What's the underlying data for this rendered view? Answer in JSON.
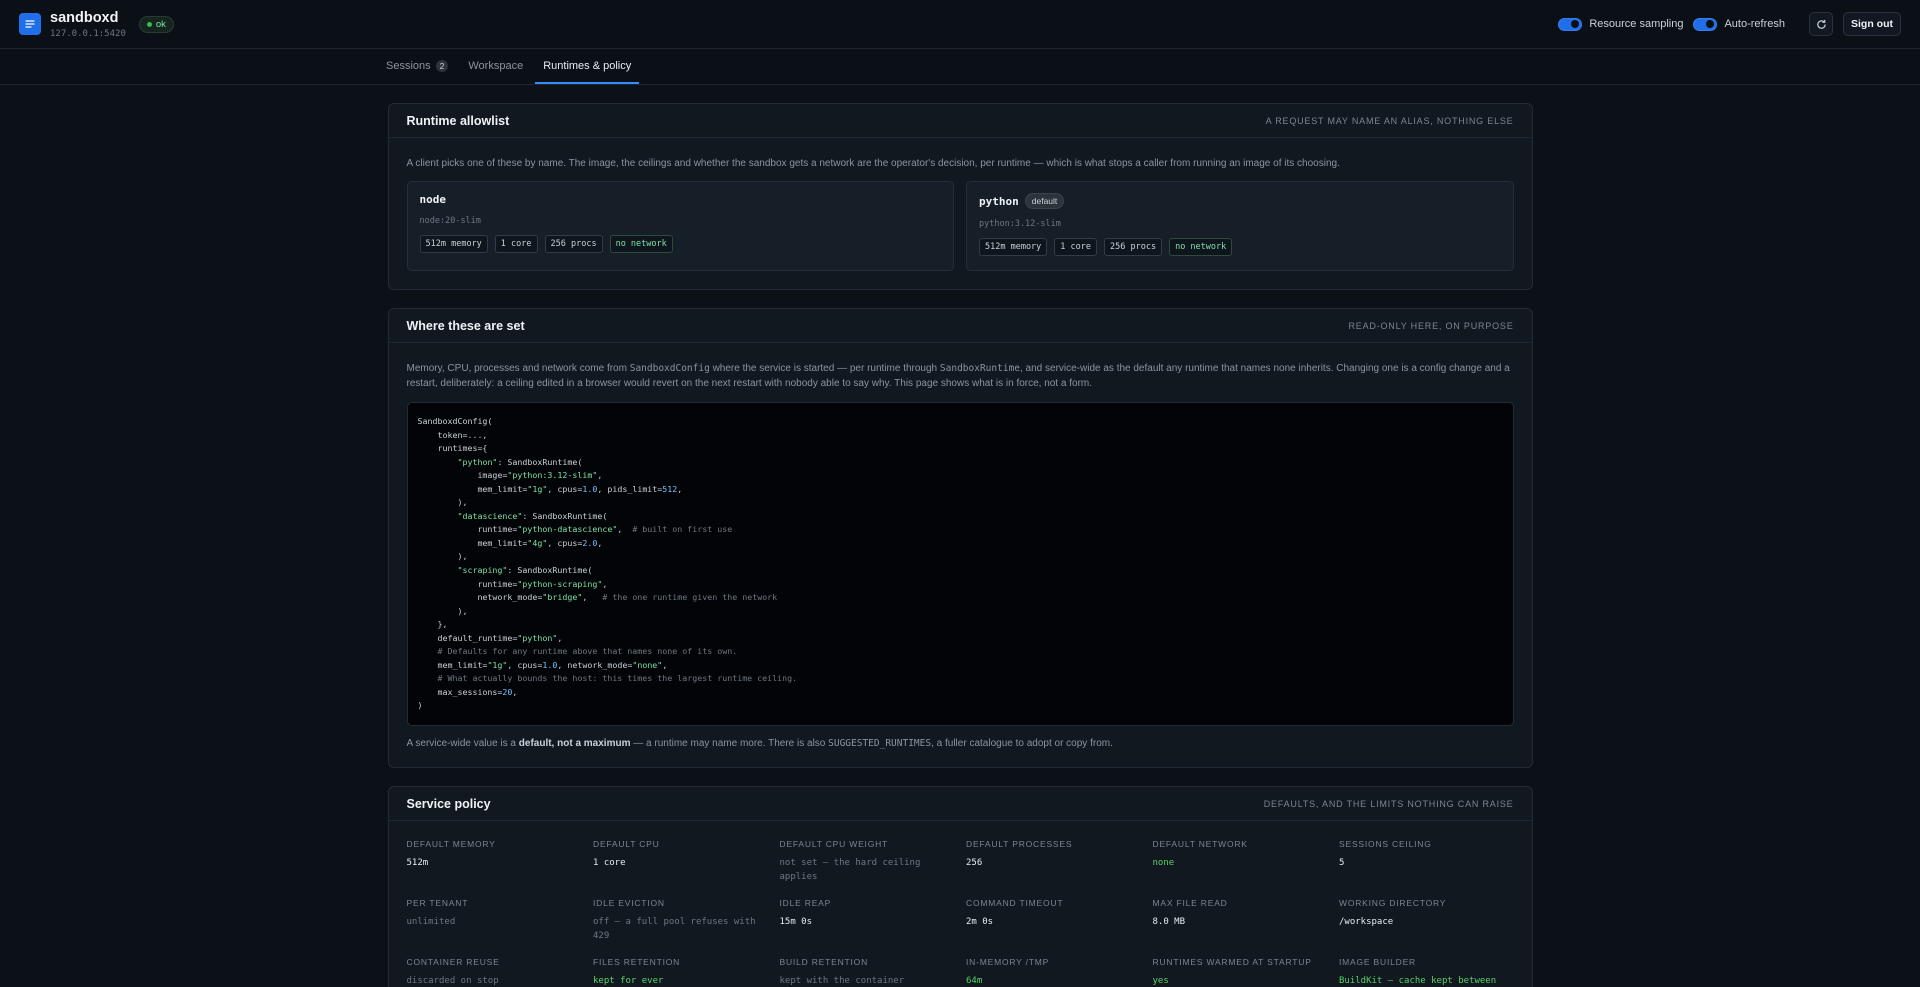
{
  "app": {
    "name": "sandboxd",
    "address": "127.0.0.1:5420",
    "status": "ok",
    "toggles": [
      {
        "label": "Resource sampling",
        "on": true
      },
      {
        "label": "Auto-refresh",
        "on": true
      }
    ],
    "refresh_icon": "refresh-icon",
    "sign_out": "Sign out"
  },
  "tabs": [
    {
      "label": "Sessions",
      "count": "2"
    },
    {
      "label": "Workspace",
      "count": ""
    },
    {
      "label": "Runtimes & policy",
      "count": "",
      "active": true
    }
  ],
  "allowlist": {
    "title": "Runtime allowlist",
    "note": "A request may name an alias, nothing else",
    "description": "A client picks one of these by name. The image, the ceilings and whether the sandbox gets a network are the operator's decision, per runtime — which is what stops a caller from running an image of its choosing.",
    "runtimes": [
      {
        "name": "node",
        "default_badge": "",
        "image": "node:20-slim",
        "chips": [
          "512m memory",
          "1 core",
          "256 procs",
          "no network"
        ]
      },
      {
        "name": "python",
        "default_badge": "default",
        "image": "python:3.12-slim",
        "chips": [
          "512m memory",
          "1 core",
          "256 procs",
          "no network"
        ]
      }
    ]
  },
  "config": {
    "title": "Where these are set",
    "note": "Read-only here, on purpose",
    "desc_parts": {
      "p1": "Memory, CPU, processes and network come from ",
      "code1": "SandboxdConfig",
      "p2": " where the service is started — per runtime through ",
      "code2": "SandboxRuntime",
      "p3": ", and service-wide as the default any runtime that names none inherits. Changing one is a config change and a restart, deliberately: a ceiling edited in a browser would revert on the next restart with nobody able to say why. This page shows what is in force, not a form."
    },
    "code_lines": [
      "SandboxdConfig(",
      "    token=...,",
      "    runtimes={",
      "        \"python\": SandboxRuntime(",
      "            image=\"python:3.12-slim\",",
      "            mem_limit=\"1g\", cpus=1.0, pids_limit=512,",
      "        ),",
      "        \"datascience\": SandboxRuntime(",
      "            runtime=\"python-datascience\",  # built on first use",
      "            mem_limit=\"4g\", cpus=2.0,",
      "        ),",
      "        \"scraping\": SandboxRuntime(",
      "            runtime=\"python-scraping\",",
      "            network_mode=\"bridge\",   # the one runtime given the network",
      "        ),",
      "    },",
      "    default_runtime=\"python\",",
      "    # Defaults for any runtime above that names none of its own.",
      "    mem_limit=\"1g\", cpus=1.0, network_mode=\"none\",",
      "    # What actually bounds the host: this times the largest runtime ceiling.",
      "    max_sessions=20,",
      ")"
    ],
    "foot_parts": {
      "p1": "A service-wide value is a ",
      "bold": "default, not a maximum",
      "p2": " — a runtime may name more. There is also ",
      "code": "SUGGESTED_RUNTIMES",
      "p3": ", a fuller catalogue to adopt or copy from."
    }
  },
  "policy": {
    "title": "Service policy",
    "note": "Defaults, and the limits nothing can raise",
    "items": [
      {
        "label": "Default memory",
        "value": "512m",
        "tone": ""
      },
      {
        "label": "Default CPU",
        "value": "1 core",
        "tone": ""
      },
      {
        "label": "Default CPU weight",
        "value": "not set — the hard ceiling applies",
        "tone": "muted"
      },
      {
        "label": "Default processes",
        "value": "256",
        "tone": ""
      },
      {
        "label": "Default network",
        "value": "none",
        "tone": "green"
      },
      {
        "label": "Sessions ceiling",
        "value": "5",
        "tone": ""
      },
      {
        "label": "Per tenant",
        "value": "unlimited",
        "tone": "muted"
      },
      {
        "label": "Idle eviction",
        "value": "off — a full pool refuses with 429",
        "tone": "muted"
      },
      {
        "label": "Idle reap",
        "value": "15m 0s",
        "tone": ""
      },
      {
        "label": "Command timeout",
        "value": "2m 0s",
        "tone": ""
      },
      {
        "label": "Max file read",
        "value": "8.0 MB",
        "tone": ""
      },
      {
        "label": "Working directory",
        "value": "/workspace",
        "tone": ""
      },
      {
        "label": "Container reuse",
        "value": "discarded on stop",
        "tone": "muted"
      },
      {
        "label": "Files retention",
        "value": "kept for ever",
        "tone": "green"
      },
      {
        "label": "Build retention",
        "value": "kept with the container",
        "tone": "muted"
      },
      {
        "label": "In-memory /tmp",
        "value": "64m",
        "tone": "green"
      },
      {
        "label": "Runtimes warmed at startup",
        "value": "yes",
        "tone": "green"
      },
      {
        "label": "Image builder",
        "value": "BuildKit — cache kept between",
        "tone": "green"
      }
    ]
  }
}
